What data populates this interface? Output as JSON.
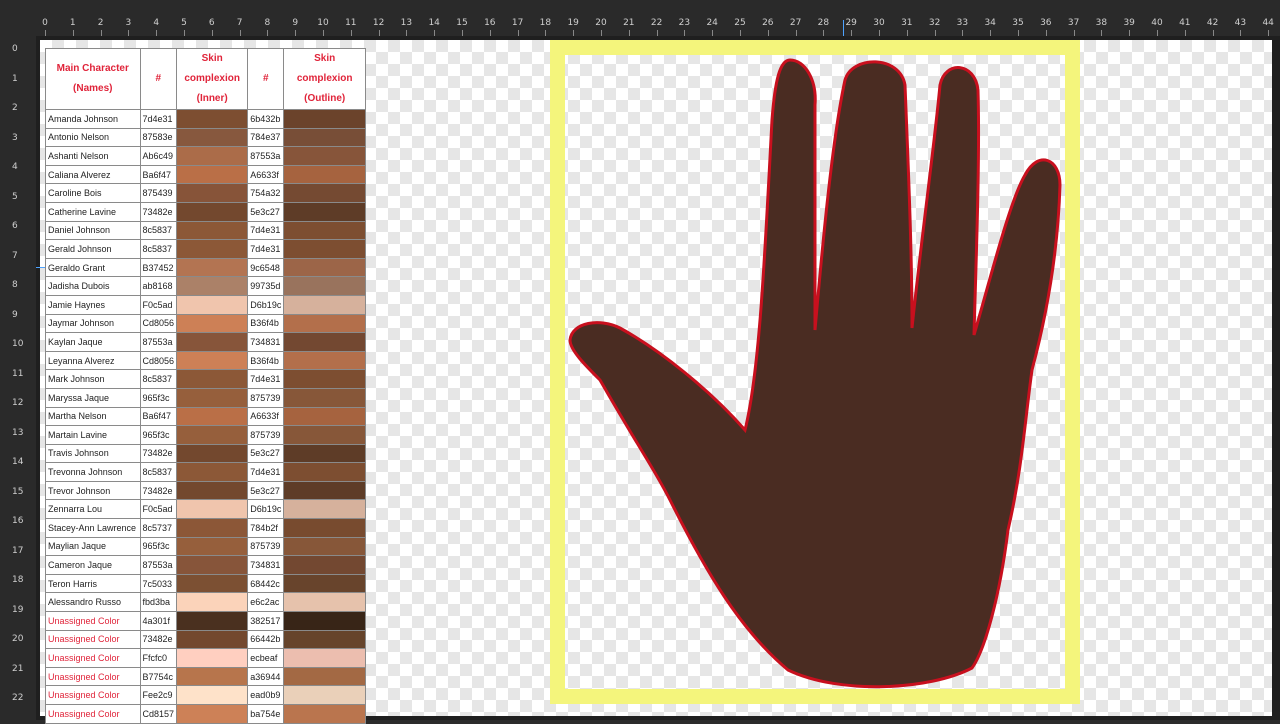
{
  "ruler": {
    "top_numbers": [
      "0",
      "1",
      "2",
      "3",
      "4",
      "5",
      "6",
      "7",
      "8",
      "9",
      "10",
      "11",
      "12",
      "13",
      "14",
      "15",
      "16",
      "17",
      "18",
      "19",
      "20",
      "21",
      "22",
      "23",
      "24",
      "25",
      "26",
      "27",
      "28",
      "29",
      "30",
      "31",
      "32",
      "33",
      "34",
      "35",
      "36",
      "37",
      "38",
      "39",
      "40",
      "41",
      "42",
      "43",
      "44"
    ],
    "left_numbers": [
      "0",
      "1",
      "2",
      "3",
      "4",
      "5",
      "6",
      "7",
      "8",
      "9",
      "10",
      "11",
      "12",
      "13",
      "14",
      "15",
      "16",
      "17",
      "18",
      "19",
      "20",
      "21",
      "22"
    ]
  },
  "table": {
    "headers": [
      "Main Character (Names)",
      "#",
      "Skin complexion (Inner)",
      "#",
      "Skin complexion (Outline)"
    ],
    "rows": [
      {
        "name": "Amanda Johnson",
        "hex1": "7d4e31",
        "color1": "#7d4e31",
        "hex2": "6b432b",
        "color2": "#6b432b",
        "unassigned": false
      },
      {
        "name": "Antonio Nelson",
        "hex1": "87583e",
        "color1": "#87583e",
        "hex2": "784e37",
        "color2": "#784e37",
        "unassigned": false
      },
      {
        "name": "Ashanti Nelson",
        "hex1": "Ab6c49",
        "color1": "#ab6c49",
        "hex2": "87553a",
        "color2": "#87553a",
        "unassigned": false
      },
      {
        "name": "Caliana Alverez",
        "hex1": "Ba6f47",
        "color1": "#ba6f47",
        "hex2": "A6633f",
        "color2": "#a6633f",
        "unassigned": false
      },
      {
        "name": "Caroline Bois",
        "hex1": "875439",
        "color1": "#875439",
        "hex2": "754a32",
        "color2": "#754a32",
        "unassigned": false
      },
      {
        "name": "Catherine Lavine",
        "hex1": "73482e",
        "color1": "#73482e",
        "hex2": "5e3c27",
        "color2": "#5e3c27",
        "unassigned": false
      },
      {
        "name": "Daniel Johnson",
        "hex1": "8c5837",
        "color1": "#8c5837",
        "hex2": "7d4e31",
        "color2": "#7d4e31",
        "unassigned": false
      },
      {
        "name": "Gerald Johnson",
        "hex1": "8c5837",
        "color1": "#8c5837",
        "hex2": "7d4e31",
        "color2": "#7d4e31",
        "unassigned": false
      },
      {
        "name": "Geraldo Grant",
        "hex1": "B37452",
        "color1": "#b37452",
        "hex2": "9c6548",
        "color2": "#9c6548",
        "unassigned": false
      },
      {
        "name": "Jadisha Dubois",
        "hex1": "ab8168",
        "color1": "#ab8168",
        "hex2": "99735d",
        "color2": "#99735d",
        "unassigned": false
      },
      {
        "name": "Jamie Haynes",
        "hex1": "F0c5ad",
        "color1": "#f0c5ad",
        "hex2": "D6b19c",
        "color2": "#d6b19c",
        "unassigned": false
      },
      {
        "name": "Jaymar Johnson",
        "hex1": "Cd8056",
        "color1": "#cd8056",
        "hex2": "B36f4b",
        "color2": "#b36f4b",
        "unassigned": false
      },
      {
        "name": "Kaylan Jaque",
        "hex1": "87553a",
        "color1": "#87553a",
        "hex2": "734831",
        "color2": "#734831",
        "unassigned": false
      },
      {
        "name": "Leyanna Alverez",
        "hex1": "Cd8056",
        "color1": "#cd8056",
        "hex2": "B36f4b",
        "color2": "#b36f4b",
        "unassigned": false
      },
      {
        "name": "Mark Johnson",
        "hex1": "8c5837",
        "color1": "#8c5837",
        "hex2": "7d4e31",
        "color2": "#7d4e31",
        "unassigned": false
      },
      {
        "name": "Maryssa Jaque",
        "hex1": "965f3c",
        "color1": "#965f3c",
        "hex2": "875739",
        "color2": "#875739",
        "unassigned": false
      },
      {
        "name": "Martha Nelson",
        "hex1": "Ba6f47",
        "color1": "#ba6f47",
        "hex2": "A6633f",
        "color2": "#a6633f",
        "unassigned": false
      },
      {
        "name": "Martain Lavine",
        "hex1": "965f3c",
        "color1": "#965f3c",
        "hex2": "875739",
        "color2": "#875739",
        "unassigned": false
      },
      {
        "name": "Travis Johnson",
        "hex1": "73482e",
        "color1": "#73482e",
        "hex2": "5e3c27",
        "color2": "#5e3c27",
        "unassigned": false
      },
      {
        "name": "Trevonna Johnson",
        "hex1": "8c5837",
        "color1": "#8c5837",
        "hex2": "7d4e31",
        "color2": "#7d4e31",
        "unassigned": false
      },
      {
        "name": "Trevor Johnson",
        "hex1": "73482e",
        "color1": "#73482e",
        "hex2": "5e3c27",
        "color2": "#5e3c27",
        "unassigned": false
      },
      {
        "name": "Zennarra Lou",
        "hex1": "F0c5ad",
        "color1": "#f0c5ad",
        "hex2": "D6b19c",
        "color2": "#d6b19c",
        "unassigned": false
      },
      {
        "name": "Stacey-Ann Lawrence",
        "hex1": "8c5737",
        "color1": "#8c5737",
        "hex2": "784b2f",
        "color2": "#784b2f",
        "unassigned": false
      },
      {
        "name": "Maylian Jaque",
        "hex1": "965f3c",
        "color1": "#965f3c",
        "hex2": "875739",
        "color2": "#875739",
        "unassigned": false
      },
      {
        "name": "Cameron Jaque",
        "hex1": "87553a",
        "color1": "#87553a",
        "hex2": "734831",
        "color2": "#734831",
        "unassigned": false
      },
      {
        "name": "Teron Harris",
        "hex1": "7c5033",
        "color1": "#7c5033",
        "hex2": "68442c",
        "color2": "#68442c",
        "unassigned": false
      },
      {
        "name": "Alessandro Russo",
        "hex1": "fbd3ba",
        "color1": "#fbd3ba",
        "hex2": "e6c2ac",
        "color2": "#e6c2ac",
        "unassigned": false
      },
      {
        "name": "Unassigned Color",
        "hex1": "4a301f",
        "color1": "#4a301f",
        "hex2": "382517",
        "color2": "#382517",
        "unassigned": true
      },
      {
        "name": "Unassigned Color",
        "hex1": "73482e",
        "color1": "#73482e",
        "hex2": "66442b",
        "color2": "#66442b",
        "unassigned": true
      },
      {
        "name": "Unassigned Color",
        "hex1": "Ffcfc0",
        "color1": "#ffcfc0",
        "hex2": "ecbeaf",
        "color2": "#ecbeaf",
        "unassigned": true
      },
      {
        "name": "Unassigned Color",
        "hex1": "B7754c",
        "color1": "#b7754c",
        "hex2": "a36944",
        "color2": "#a36944",
        "unassigned": true
      },
      {
        "name": "Unassigned Color",
        "hex1": "Fee2c9",
        "color1": "#fee2c9",
        "hex2": "ead0b9",
        "color2": "#ead0b9",
        "unassigned": true
      },
      {
        "name": "Unassigned Color",
        "hex1": "Cd8157",
        "color1": "#cd8157",
        "hex2": "ba754e",
        "color2": "#ba754e",
        "unassigned": true
      }
    ]
  },
  "artwork": {
    "hand_fill": "#4a2c22",
    "hand_outline": "#c8101e",
    "frame_color": "#f4f57c"
  }
}
